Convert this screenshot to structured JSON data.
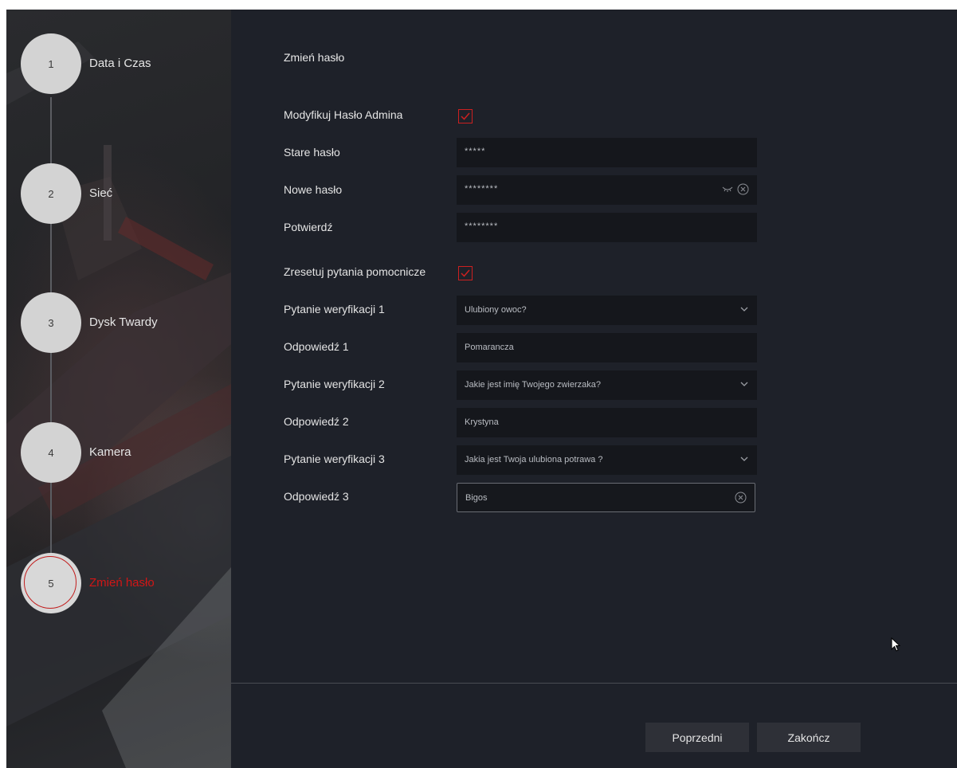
{
  "wizard": {
    "steps": [
      {
        "number": "1",
        "label": "Data i Czas"
      },
      {
        "number": "2",
        "label": "Sieć"
      },
      {
        "number": "3",
        "label": "Dysk Twardy"
      },
      {
        "number": "4",
        "label": "Kamera"
      },
      {
        "number": "5",
        "label": "Zmień hasło"
      }
    ],
    "active_step": 5,
    "active_color": "#d11616"
  },
  "form": {
    "title": "Zmień hasło",
    "modify_admin_label": "Modyfikuj Hasło Admina",
    "modify_admin_checked": true,
    "old_password_label": "Stare hasło",
    "old_password_value": "*****",
    "new_password_label": "Nowe hasło",
    "new_password_value": "********",
    "confirm_label": "Potwierdź",
    "confirm_value": "********",
    "reset_questions_label": "Zresetuj pytania pomocnicze",
    "reset_questions_checked": true,
    "question1_label": "Pytanie weryfikacji 1",
    "question1_value": "Ulubiony owoc?",
    "answer1_label": "Odpowiedź 1",
    "answer1_value": "Pomarancza",
    "question2_label": "Pytanie weryfikacji 2",
    "question2_value": "Jakie jest imię Twojego zwierzaka?",
    "answer2_label": "Odpowiedź 2",
    "answer2_value": "Krystyna",
    "question3_label": "Pytanie weryfikacji 3",
    "question3_value": "Jakia jest Twoja ulubiona potrawa ?",
    "answer3_label": "Odpowiedź 3",
    "answer3_value": "Bigos"
  },
  "buttons": {
    "previous": "Poprzedni",
    "finish": "Zakończ"
  },
  "icons": {
    "checkbox": "checkmark-icon",
    "eye": "eye-closed-icon",
    "clear": "clear-circle-icon",
    "dropdown": "chevron-down-icon"
  },
  "colors": {
    "accent": "#cc2020",
    "panel_bg": "#1e2129",
    "field_bg": "#15171c"
  }
}
